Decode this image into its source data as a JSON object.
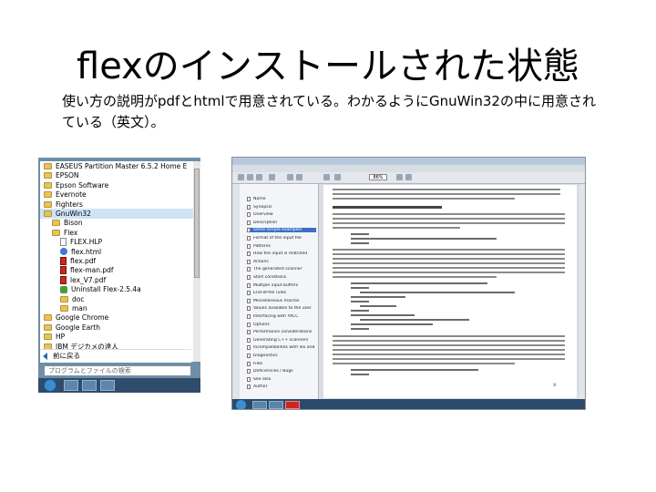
{
  "slide": {
    "title": "flexのインストールされた状態",
    "description": "使い方の説明がpdfとhtmlで用意されている。わかるようにGnuWin32の中に用意されている（英文）。"
  },
  "start_menu": {
    "items": [
      {
        "label": "EASEUS Partition Master 6.5.2 Home E",
        "icon": "folder-icon"
      },
      {
        "label": "EPSON",
        "icon": "folder-icon"
      },
      {
        "label": "Epson Software",
        "icon": "folder-icon"
      },
      {
        "label": "Evernote",
        "icon": "folder-icon"
      },
      {
        "label": "Fighters",
        "icon": "folder-icon"
      },
      {
        "label": "GnuWin32",
        "icon": "folder-icon",
        "selected": true
      },
      {
        "label": "Bison",
        "icon": "folder-icon",
        "indent": 1
      },
      {
        "label": "Flex",
        "icon": "folder-icon",
        "indent": 1
      },
      {
        "label": "FLEX.HLP",
        "icon": "file-icon",
        "indent": 2
      },
      {
        "label": "flex.html",
        "icon": "web-icon",
        "indent": 2
      },
      {
        "label": "flex.pdf",
        "icon": "pdf-icon",
        "indent": 2
      },
      {
        "label": "flex-man.pdf",
        "icon": "pdf-icon",
        "indent": 2
      },
      {
        "label": "lex_V7.pdf",
        "icon": "pdf-icon",
        "indent": 2
      },
      {
        "label": "Uninstall Flex-2.5.4a",
        "icon": "uninst-icon",
        "indent": 2
      },
      {
        "label": "doc",
        "icon": "folder-icon",
        "indent": 2
      },
      {
        "label": "man",
        "icon": "folder-icon",
        "indent": 2
      },
      {
        "label": "Google Chrome",
        "icon": "folder-icon"
      },
      {
        "label": "Google Earth",
        "icon": "folder-icon"
      },
      {
        "label": "HP",
        "icon": "folder-icon"
      },
      {
        "label": "IBM デジカメの達人",
        "icon": "folder-icon"
      }
    ],
    "back_label": "前に戻る",
    "search_placeholder": "プログラムとファイルの検索"
  },
  "pdf_viewer": {
    "zoom": "86%",
    "bookmarks": [
      {
        "label": "Name"
      },
      {
        "label": "Synopsis"
      },
      {
        "label": "Overview"
      },
      {
        "label": "Description"
      },
      {
        "label": "Some simple examples",
        "selected": true
      },
      {
        "label": "Format of the input file"
      },
      {
        "label": "Patterns"
      },
      {
        "label": "How the input is matched"
      },
      {
        "label": "Actions"
      },
      {
        "label": "The generated scanner"
      },
      {
        "label": "Start conditions"
      },
      {
        "label": "Multiple input buffers"
      },
      {
        "label": "End-of-file rules"
      },
      {
        "label": "Miscellaneous macros"
      },
      {
        "label": "Values available to the user"
      },
      {
        "label": "Interfacing with YACC"
      },
      {
        "label": "Options"
      },
      {
        "label": "Performance considerations"
      },
      {
        "label": "Generating C++ scanners"
      },
      {
        "label": "Incompatibilities with lex and POSIX"
      },
      {
        "label": "Diagnostics"
      },
      {
        "label": "Files"
      },
      {
        "label": "Deficiencies / Bugs"
      },
      {
        "label": "See also"
      },
      {
        "label": "Author"
      }
    ]
  }
}
